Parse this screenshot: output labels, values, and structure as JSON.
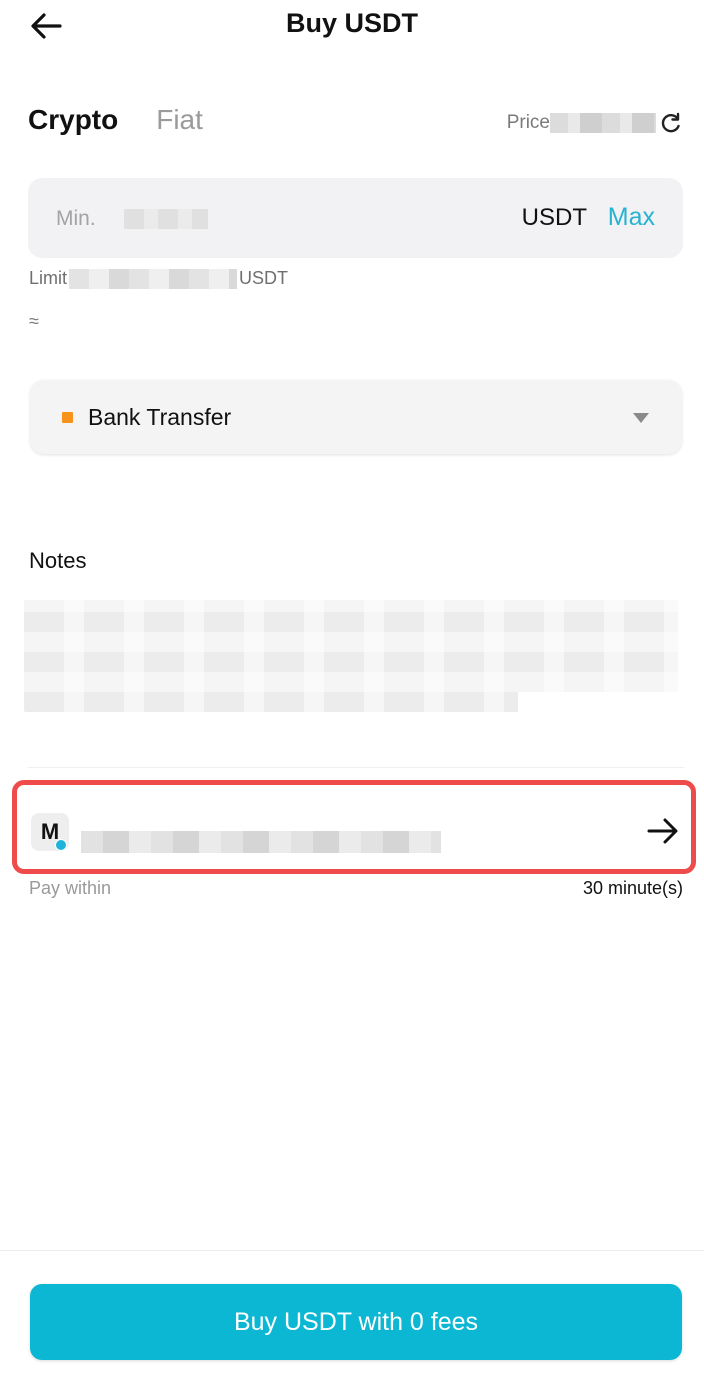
{
  "header": {
    "title": "Buy USDT"
  },
  "tabs": [
    {
      "label": "Crypto",
      "active": true
    },
    {
      "label": "Fiat",
      "active": false
    }
  ],
  "price": {
    "label": "Price"
  },
  "amount": {
    "placeholder": "Min.",
    "currency": "USDT",
    "max_label": "Max"
  },
  "limit": {
    "label": "Limit",
    "currency": "USDT"
  },
  "approx_symbol": "≈",
  "payment_method": {
    "label": "Bank Transfer",
    "color": "#f7931a"
  },
  "notes": {
    "title": "Notes"
  },
  "merchant": {
    "avatar_letter": "M",
    "online_color": "#1fb3d9"
  },
  "pay_within": {
    "label": "Pay within",
    "value": "30 minute(s)"
  },
  "buy_button": {
    "label": "Buy USDT with 0 fees",
    "color": "#0bb7d3"
  },
  "icons": {
    "back": "arrow-left-icon",
    "refresh": "refresh-icon",
    "caret": "caret-down-icon",
    "merchant_arrow": "arrow-right-icon"
  }
}
